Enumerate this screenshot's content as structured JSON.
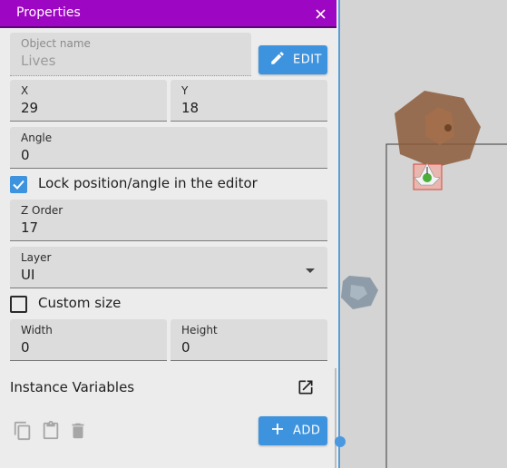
{
  "panel": {
    "title": "Properties",
    "close_icon": "close-icon"
  },
  "object_name": {
    "label": "Object name",
    "value": "Lives"
  },
  "edit_button": {
    "label": "EDIT",
    "icon": "pencil-icon"
  },
  "position": {
    "x_label": "X",
    "x_value": "29",
    "y_label": "Y",
    "y_value": "18"
  },
  "angle": {
    "label": "Angle",
    "value": "0"
  },
  "lock": {
    "label": "Lock position/angle in the editor",
    "checked": true
  },
  "z_order": {
    "label": "Z Order",
    "value": "17"
  },
  "layer": {
    "label": "Layer",
    "value": "UI"
  },
  "custom_size": {
    "label": "Custom size",
    "checked": false
  },
  "size": {
    "width_label": "Width",
    "width_value": "0",
    "height_label": "Height",
    "height_value": "0"
  },
  "instance_variables": {
    "title": "Instance Variables",
    "open_icon": "open-in-new-icon"
  },
  "toolbar": {
    "copy_icon": "copy-icon",
    "paste_icon": "paste-icon",
    "delete_icon": "delete-icon",
    "add_label": "ADD",
    "add_icon": "plus-icon"
  },
  "colors": {
    "titlebar": "#9d06c2",
    "accent": "#3d93de",
    "field_bg": "#dcdcdc",
    "panel_bg": "#ececec",
    "canvas_bg": "#d4d4d4"
  }
}
